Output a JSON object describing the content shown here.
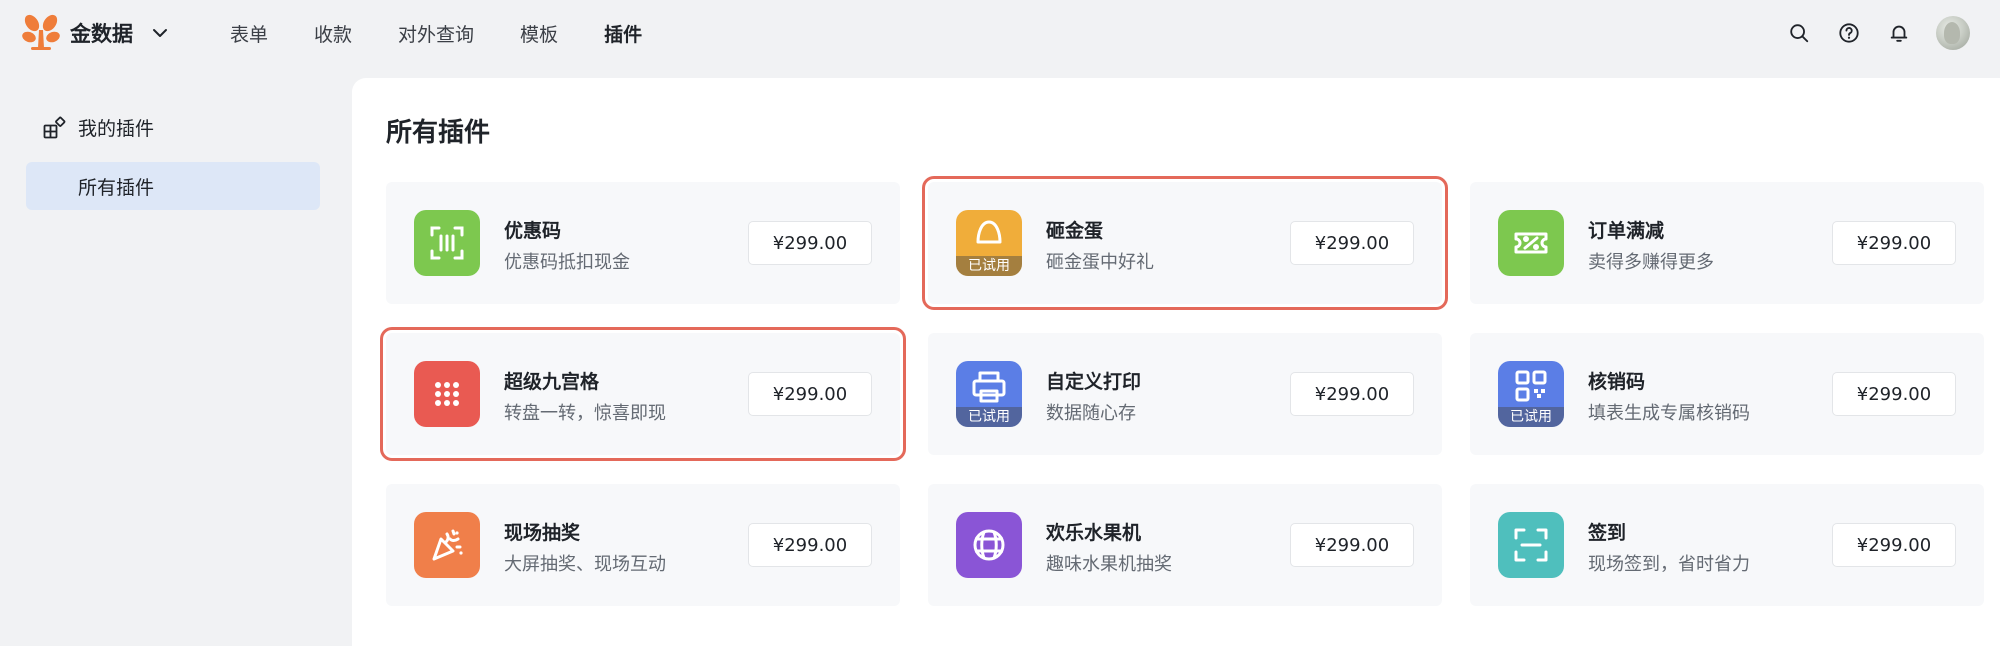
{
  "brand": {
    "name": "金数据",
    "logo_icon": "tree-logo-icon",
    "accent": "#ef7d3a"
  },
  "nav": {
    "items": [
      {
        "label": "表单",
        "active": false
      },
      {
        "label": "收款",
        "active": false
      },
      {
        "label": "对外查询",
        "active": false
      },
      {
        "label": "模板",
        "active": false
      },
      {
        "label": "插件",
        "active": true
      }
    ]
  },
  "top_icons": [
    "search-icon",
    "help-icon",
    "bell-icon",
    "avatar"
  ],
  "sidebar": {
    "group_label": "我的插件",
    "group_icon": "plugins-icon",
    "active_item": "所有插件"
  },
  "main": {
    "title": "所有插件",
    "highlight_color": "#e4695a",
    "tried_label": "已试用",
    "plugins": [
      {
        "name": "优惠码",
        "desc": "优惠码抵扣现金",
        "price": "¥299.00",
        "icon": "coupon-code-icon",
        "color": "#7dc84f",
        "tried": false,
        "highlighted": false
      },
      {
        "name": "砸金蛋",
        "desc": "砸金蛋中好礼",
        "price": "¥299.00",
        "icon": "golden-egg-icon",
        "color": "#f0ad3a",
        "tried": true,
        "highlighted": true
      },
      {
        "name": "订单满减",
        "desc": "卖得多赚得更多",
        "price": "¥299.00",
        "icon": "ticket-discount-icon",
        "color": "#7dc84f",
        "tried": false,
        "highlighted": false
      },
      {
        "name": "超级九宫格",
        "desc": "转盘一转，惊喜即现",
        "price": "¥299.00",
        "icon": "nine-grid-icon",
        "color": "#e95a52",
        "tried": false,
        "highlighted": true
      },
      {
        "name": "自定义打印",
        "desc": "数据随心存",
        "price": "¥299.00",
        "icon": "printer-icon",
        "color": "#5b7ee6",
        "tried": true,
        "highlighted": false
      },
      {
        "name": "核销码",
        "desc": "填表生成专属核销码",
        "price": "¥299.00",
        "icon": "qr-code-icon",
        "color": "#5b7ee6",
        "tried": true,
        "highlighted": false
      },
      {
        "name": "现场抽奖",
        "desc": "大屏抽奖、现场互动",
        "price": "¥299.00",
        "icon": "party-popper-icon",
        "color": "#f07f4a",
        "tried": false,
        "highlighted": false
      },
      {
        "name": "欢乐水果机",
        "desc": "趣味水果机抽奖",
        "price": "¥299.00",
        "icon": "fruit-machine-icon",
        "color": "#8a55d6",
        "tried": false,
        "highlighted": false
      },
      {
        "name": "签到",
        "desc": "现场签到，省时省力",
        "price": "¥299.00",
        "icon": "scan-checkin-icon",
        "color": "#4fbfbd",
        "tried": false,
        "highlighted": false
      }
    ]
  }
}
